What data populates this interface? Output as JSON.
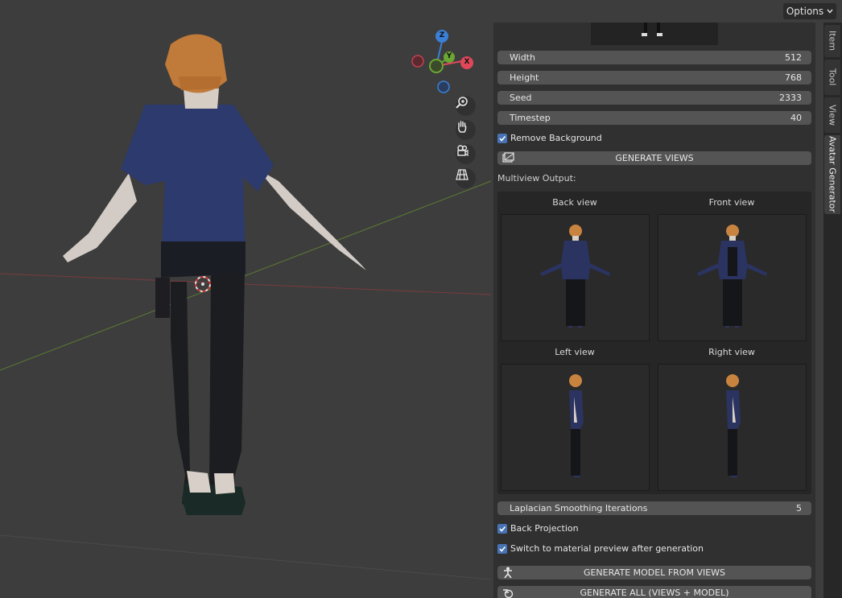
{
  "header": {
    "options_label": "Options"
  },
  "gizmo": {
    "z": "Z",
    "y": "Y",
    "x": "X"
  },
  "panel": {
    "fields": [
      {
        "label": "Width",
        "value": "512"
      },
      {
        "label": "Height",
        "value": "768"
      },
      {
        "label": "Seed",
        "value": "2333"
      },
      {
        "label": "Timestep",
        "value": "40"
      }
    ],
    "remove_background": "Remove Background",
    "generate_views": "GENERATE VIEWS",
    "multiview_label": "Multiview Output:",
    "views": [
      "Back view",
      "Front view",
      "Left view",
      "Right view"
    ],
    "smoothing": {
      "label": "Laplacian Smoothing Iterations",
      "value": "5"
    },
    "back_projection": "Back Projection",
    "switch_material": "Switch to material preview after generation",
    "generate_model": "GENERATE MODEL FROM VIEWS",
    "generate_all": "GENERATE ALL (VIEWS + MODEL)"
  },
  "tabs": [
    "Item",
    "Tool",
    "View",
    "Avatar Generator"
  ],
  "colors": {
    "viewport_bg": "#3d3d3d",
    "panel_bg": "#303030",
    "field_bg": "#545454",
    "checkbox": "#4772b3",
    "axis_x": "#e0485a",
    "axis_y": "#6ba533",
    "axis_z": "#3b7fd6"
  }
}
